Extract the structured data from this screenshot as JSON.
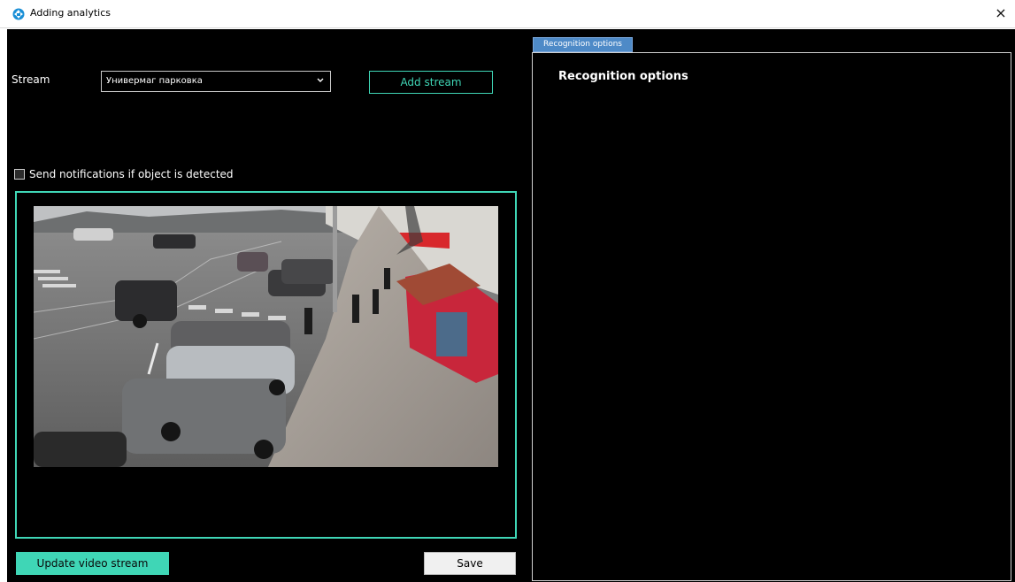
{
  "window": {
    "title": "Adding analytics",
    "close_glyph": "×"
  },
  "stream": {
    "label": "Stream",
    "selected": "Универмаг парковка",
    "add_button": "Add stream"
  },
  "notifications": {
    "checked": false,
    "label": "Send notifications if object is detected"
  },
  "video": {
    "accent_color": "#3fd6b6",
    "update_button": "Update video stream",
    "save_button": "Save"
  },
  "recognition": {
    "tab_label": "Recognition options",
    "heading": "Recognition options",
    "tab_color": "#4e8ac7"
  }
}
